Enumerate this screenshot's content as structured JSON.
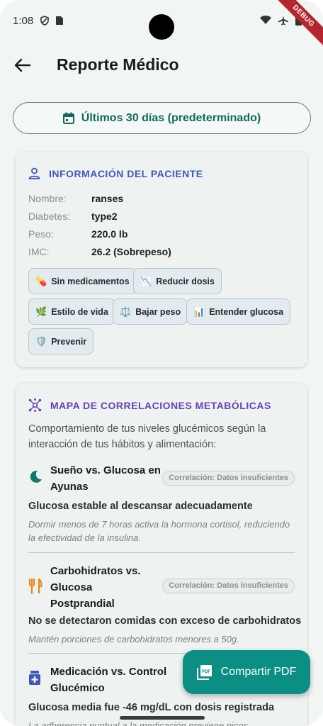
{
  "status_bar": {
    "time": "1:08",
    "debug_label": "DEBUG"
  },
  "app_bar": {
    "title": "Reporte Médico"
  },
  "date_range": {
    "label": "Últimos 30 días (predeterminado)"
  },
  "patient_card": {
    "title": "INFORMACIÓN DEL PACIENTE",
    "rows": [
      {
        "label": "Nombre:",
        "value": "ranses"
      },
      {
        "label": "Diabetes:",
        "value": "type2"
      },
      {
        "label": "Peso:",
        "value": "220.0 lb"
      },
      {
        "label": "IMC:",
        "value": "26.2 (Sobrepeso)"
      }
    ],
    "chips": [
      {
        "icon": "💊",
        "label": "Sin medicamentos"
      },
      {
        "icon": "📉",
        "label": "Reducir dosis"
      },
      {
        "icon": "🌿",
        "label": "Estilo de vida"
      },
      {
        "icon": "⚖️",
        "label": "Bajar peso"
      },
      {
        "icon": "📊",
        "label": "Entender glucosa"
      },
      {
        "icon": "🛡️",
        "label": "Prevenir"
      }
    ]
  },
  "correlations_card": {
    "title": "MAPA DE CORRELACIONES METABÓLICAS",
    "intro": "Comportamiento de tus niveles glucémicos según la interacción de tus hábitos y alimentación:",
    "items": [
      {
        "title_line1": "Sueño vs. Glucosa en",
        "title_line2": "Ayunas",
        "badge": "Correlación: Datos insuficientes",
        "summary": "Glucosa estable al descansar adecuadamente",
        "note": "Dormir menos de 7 horas activa la hormona cortisol, reduciendo la efectividad de la insulina."
      },
      {
        "title_line1": "Carbohidratos vs.",
        "title_line2": "Glucosa",
        "title_line3": "Postprandial",
        "badge": "Correlación: Datos insuficientes",
        "summary": "No se detectaron comidas con exceso de carbohidratos",
        "note": "Mantén porciones de carbohidratos menores a 50g."
      },
      {
        "title_line1": "Medicación vs. Control",
        "title_line2": "Glucémico",
        "summary": "Glucosa media fue -46 mg/dL con dosis registrada",
        "note": "La adherencia puntual a la medicación previene picos"
      }
    ]
  },
  "fab": {
    "label": "Compartir PDF"
  },
  "colors": {
    "accent": "#0a8f82",
    "patient_title": "#3f57b8",
    "corr_title": "#6a3fb8"
  }
}
